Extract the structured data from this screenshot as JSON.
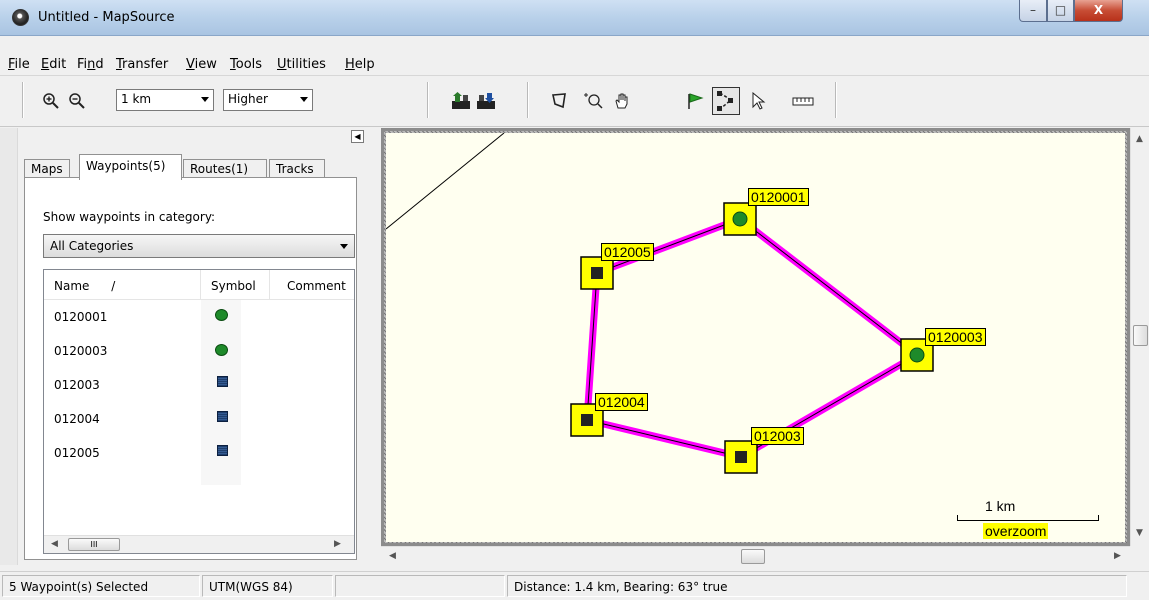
{
  "window": {
    "title": "Untitled - MapSource"
  },
  "menu": [
    {
      "pre": "",
      "u": "F",
      "post": "ile"
    },
    {
      "pre": "",
      "u": "E",
      "post": "dit"
    },
    {
      "pre": "Fi",
      "u": "n",
      "post": "d"
    },
    {
      "pre": "",
      "u": "T",
      "post": "ransfer"
    },
    {
      "pre": "",
      "u": "V",
      "post": "iew"
    },
    {
      "pre": "",
      "u": "T",
      "post": "ools"
    },
    {
      "pre": "",
      "u": "U",
      "post": "tilities"
    },
    {
      "pre": "",
      "u": "H",
      "post": "elp"
    }
  ],
  "toolbar": {
    "scale_value": "1 km",
    "detail_value": "Higher",
    "icons": [
      "zoom-in-icon",
      "zoom-out-icon",
      "receive-from-device-icon",
      "send-to-device-icon",
      "map-select-icon",
      "zoom-tool-icon",
      "hand-tool-icon",
      "waypoint-flag-icon",
      "route-tool-icon",
      "selection-arrow-icon",
      "distance-ruler-icon"
    ]
  },
  "panel": {
    "tabs": [
      "Maps",
      "Waypoints(5)",
      "Routes(1)",
      "Tracks"
    ],
    "active_tab": "Waypoints(5)",
    "category_label": "Show waypoints in category:",
    "category_value": "All Categories",
    "columns": [
      "Name",
      "/",
      "Symbol",
      "Comment"
    ],
    "waypoints": [
      {
        "name": "0120001",
        "symbol": "green-dot"
      },
      {
        "name": "0120003",
        "symbol": "green-dot"
      },
      {
        "name": "012003",
        "symbol": "blue-square"
      },
      {
        "name": "012004",
        "symbol": "blue-square"
      },
      {
        "name": "012005",
        "symbol": "blue-square"
      }
    ],
    "hscroll_thumb": "III"
  },
  "map": {
    "background": "#fffff0",
    "route_color": "#ff00ff",
    "label_bg": "#ffff00",
    "waypoints": [
      {
        "label": "0120001",
        "symbol": "dot"
      },
      {
        "label": "012005",
        "symbol": "square"
      },
      {
        "label": "0120003",
        "symbol": "dot"
      },
      {
        "label": "012004",
        "symbol": "square"
      },
      {
        "label": "012003",
        "symbol": "square"
      }
    ],
    "scale_label": "1 km",
    "overzoom_label": "overzoom"
  },
  "status": {
    "selection": "5 Waypoint(s) Selected",
    "datum": "UTM(WGS 84)",
    "distance": "Distance: 1.4 km, Bearing: 63° true"
  }
}
